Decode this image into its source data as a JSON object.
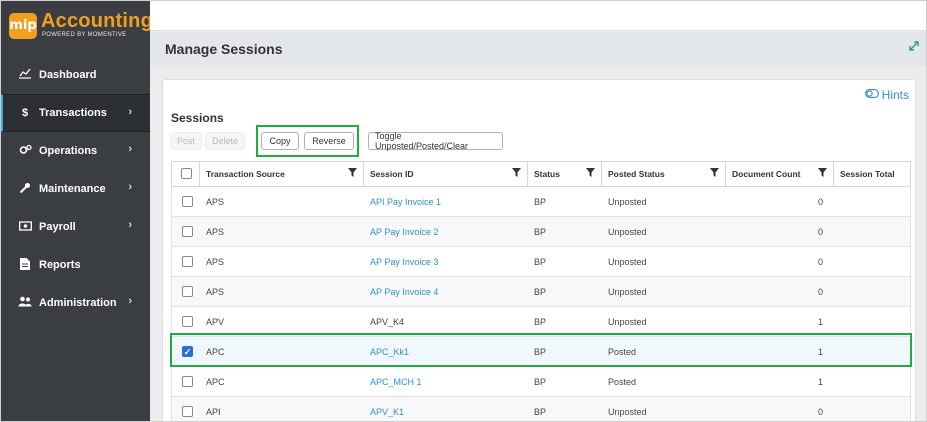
{
  "app": {
    "logo_badge": "mip",
    "logo_title": "Accounting",
    "logo_subtitle": "POWERED BY MOMENTIVE"
  },
  "sidebar": {
    "items": [
      {
        "label": "Dashboard",
        "icon": "chart-line-icon",
        "glyph": "📈",
        "chevron": false
      },
      {
        "label": "Transactions",
        "icon": "dollar-icon",
        "glyph": "$",
        "chevron": true,
        "active": true
      },
      {
        "label": "Operations",
        "icon": "gears-icon",
        "glyph": "⚙",
        "chevron": true
      },
      {
        "label": "Maintenance",
        "icon": "wrench-icon",
        "glyph": "🔧",
        "chevron": true
      },
      {
        "label": "Payroll",
        "icon": "money-icon",
        "glyph": "💵",
        "chevron": true
      },
      {
        "label": "Reports",
        "icon": "file-icon",
        "glyph": "📄",
        "chevron": false
      },
      {
        "label": "Administration",
        "icon": "users-icon",
        "glyph": "👥",
        "chevron": true
      }
    ]
  },
  "header": {
    "title": "Manage Sessions"
  },
  "panel": {
    "hints_label": "Hints",
    "section_title": "Sessions",
    "buttons": {
      "post": "Post",
      "delete": "Delete",
      "copy": "Copy",
      "reverse": "Reverse",
      "toggle": "Toggle Unposted/Posted/Clear"
    }
  },
  "table": {
    "columns": [
      "Transaction Source",
      "Session ID",
      "Status",
      "Posted Status",
      "Document Count",
      "Session Total"
    ],
    "rows": [
      {
        "source": "APS",
        "session_id": "API Pay Invoice 1",
        "link": true,
        "status": "BP",
        "posted": "Unposted",
        "count": "0",
        "checked": false
      },
      {
        "source": "APS",
        "session_id": "AP Pay Invoice 2",
        "link": true,
        "status": "BP",
        "posted": "Unposted",
        "count": "0",
        "checked": false
      },
      {
        "source": "APS",
        "session_id": "AP Pay Invoice 3",
        "link": true,
        "status": "BP",
        "posted": "Unposted",
        "count": "0",
        "checked": false
      },
      {
        "source": "APS",
        "session_id": "AP Pay Invoice 4",
        "link": true,
        "status": "BP",
        "posted": "Unposted",
        "count": "0",
        "checked": false
      },
      {
        "source": "APV",
        "session_id": "APV_K4",
        "link": false,
        "status": "BP",
        "posted": "Unposted",
        "count": "1",
        "checked": false
      },
      {
        "source": "APC",
        "session_id": "APC_Kk1",
        "link": true,
        "status": "BP",
        "posted": "Posted",
        "count": "1",
        "checked": true
      },
      {
        "source": "APC",
        "session_id": "APC_MCH 1",
        "link": true,
        "status": "BP",
        "posted": "Posted",
        "count": "1",
        "checked": false
      },
      {
        "source": "API",
        "session_id": "APV_K1",
        "link": true,
        "status": "BP",
        "posted": "Unposted",
        "count": "0",
        "checked": false
      }
    ]
  },
  "colors": {
    "accent": "#2f8fd0",
    "highlight": "#22aa44",
    "sidebar": "#3a3d41",
    "logo": "#f0a020"
  }
}
